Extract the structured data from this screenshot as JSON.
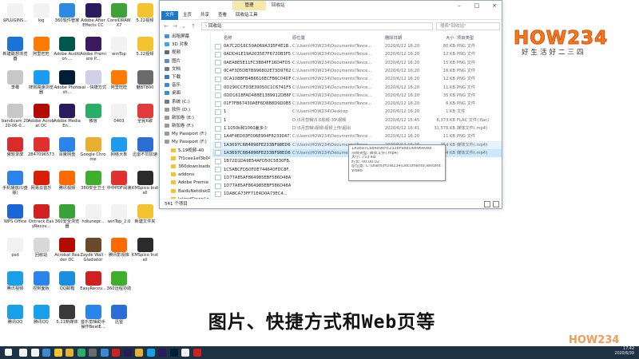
{
  "desktop": {
    "icons": [
      {
        "label": "$PLUGINS...",
        "color": "#f2f2f2"
      },
      {
        "label": "log",
        "color": "#f2f2f2"
      },
      {
        "label": "360软件管家",
        "color": "#2d8ae0"
      },
      {
        "label": "Adobe After Effects CC",
        "color": "#2a1a5e"
      },
      {
        "label": "CorelDRAW X7",
        "color": "#3fa13a"
      },
      {
        "label": "5.22视频",
        "color": "#f4c430"
      },
      {
        "label": "新建联想浏览器",
        "color": "#1b73d6"
      },
      {
        "label": "阿里旺旺",
        "color": "#ff7a00"
      },
      {
        "label": "Adobe Audition ...",
        "color": "#00574b"
      },
      {
        "label": "Adobe Premiere P...",
        "color": "#3b1a5e"
      },
      {
        "label": "winTop",
        "color": "#f2f2f2"
      },
      {
        "label": "5.22视频",
        "color": "#f4c430"
      },
      {
        "label": "李霉",
        "color": "#c8c8c8"
      },
      {
        "label": "搜狗高速浏览器",
        "color": "#1c9bf0"
      },
      {
        "label": "Adobe Photosh...",
        "color": "#001e36"
      },
      {
        "label": "sai - 快捷方式",
        "color": "#d0d0e8"
      },
      {
        "label": "阿里旺旺",
        "color": "#ff7a00"
      },
      {
        "label": "魅BT800",
        "color": "#6b6b6b"
      },
      {
        "label": "bandicam 2020-06-0...",
        "color": "#c8c8c8"
      },
      {
        "label": "Adobe Acrobat DC",
        "color": "#b30b00"
      },
      {
        "label": "Adobe Media En...",
        "color": "#2a1a5e"
      },
      {
        "label": "微信",
        "color": "#2aae67"
      },
      {
        "label": "0403",
        "color": "#f2f2f2"
      },
      {
        "label": "全民K歌",
        "color": "#e23a3a"
      },
      {
        "label": "傲软录屏",
        "color": "#d92b2b"
      },
      {
        "label": "2847096573",
        "color": "#e03030"
      },
      {
        "label": "百度网盘",
        "color": "#2b84ea"
      },
      {
        "label": "Google Chrome",
        "color": "#e8b030"
      },
      {
        "label": "网络大象",
        "color": "#1c9bf0"
      },
      {
        "label": "迅雷不同加速",
        "color": "#2b6fd6"
      },
      {
        "label": "手机播放(U盘版)",
        "color": "#2b84ea"
      },
      {
        "label": "网易云音乐",
        "color": "#d81e06"
      },
      {
        "label": "腾讯视频",
        "color": "#ff6a00"
      },
      {
        "label": "360安全卫士",
        "color": "#3fae2a"
      },
      {
        "label": "中中PDF阅读",
        "color": "#e03030"
      },
      {
        "label": "KMSpico Install",
        "color": "#2b2b2b"
      },
      {
        "label": "WPS Office",
        "color": "#1a66d6"
      },
      {
        "label": "Ontrack EasyRecov...",
        "color": "#d02020"
      },
      {
        "label": "360安全浏览器",
        "color": "#3aa23a"
      },
      {
        "label": "hdtunepr...",
        "color": "#f2f2f2"
      },
      {
        "label": "winTop_2.0",
        "color": "#f2f2f2"
      },
      {
        "label": "新建文件夹",
        "color": "#f4c430"
      },
      {
        "label": "psd",
        "color": "#f2f2f2"
      },
      {
        "label": "回收站",
        "color": "#d8d8d8"
      },
      {
        "label": "Acrobat Reader DC",
        "color": "#b30b00"
      },
      {
        "label": "Zayde Wall - Gladiator",
        "color": "#6b4a2a"
      },
      {
        "label": "腾讯影视库",
        "color": "#ff6a00"
      },
      {
        "label": "KMSpico Install",
        "color": "#2b2b2b"
      },
      {
        "label": "腾讯视频",
        "color": "#1aa0e8"
      },
      {
        "label": "控制面板",
        "color": "#2b84ea"
      },
      {
        "label": "QQ邮箱",
        "color": "#1a8fe0"
      },
      {
        "label": "EasyRecov...",
        "color": "#d02020"
      },
      {
        "label": "360远程协助",
        "color": "#3fae2a"
      },
      {
        "label": "",
        "color": "#ffffff"
      },
      {
        "label": "腾讯QQ",
        "color": "#1aa0e8"
      },
      {
        "label": "腾讯QQ",
        "color": "#1aa0e8"
      },
      {
        "label": "5.11新媒体",
        "color": "#3a3a3a"
      },
      {
        "label": "音乐剪辑助手操作BeatE...",
        "color": "#2b84ea"
      },
      {
        "label": "迅雷",
        "color": "#2b6fd6"
      }
    ]
  },
  "window": {
    "context_tab": "管理",
    "title": "回收站",
    "ribbon_tabs": [
      "文件",
      "主页",
      "共享",
      "查看",
      "回收站工具"
    ],
    "address": "› 回收站",
    "search_placeholder": "搜索\"回收站\"",
    "nav": [
      {
        "label": "出租屏幕",
        "color": "#4a90e2",
        "sub": false
      },
      {
        "label": "3D 对象",
        "color": "#3ea6e8",
        "sub": false
      },
      {
        "label": "视频",
        "color": "#5b6b7b",
        "sub": false
      },
      {
        "label": "图片",
        "color": "#5b8bd6",
        "sub": false
      },
      {
        "label": "文档",
        "color": "#6b7b8b",
        "sub": false
      },
      {
        "label": "下载",
        "color": "#2a7ad6",
        "sub": false
      },
      {
        "label": "音乐",
        "color": "#3a8ad6",
        "sub": false
      },
      {
        "label": "桌面",
        "color": "#3a8ad6",
        "sub": false
      },
      {
        "label": "系统 (C:)",
        "color": "#6b7b8b",
        "sub": false
      },
      {
        "label": "软件 (D:)",
        "color": "#9a9a9a",
        "sub": false
      },
      {
        "label": "新加卷 (E:)",
        "color": "#9a9a9a",
        "sub": false
      },
      {
        "label": "新加卷 (F:)",
        "color": "#9a9a9a",
        "sub": false
      },
      {
        "label": "My Passport (F:)",
        "color": "#9a9a9a",
        "sub": false
      },
      {
        "label": "My Passport (F:)",
        "color": "#9a9a9a",
        "sub": false
      },
      {
        "label": "5.19视频-40",
        "color": "#f4c430",
        "sub": true
      },
      {
        "label": "7f1cee1ef3b04",
        "color": "#f4c430",
        "sub": true
      },
      {
        "label": "360downloads",
        "color": "#f4c430",
        "sub": true
      },
      {
        "label": "addons",
        "color": "#f4c430",
        "sub": true
      },
      {
        "label": "Adobe Premie",
        "color": "#f4c430",
        "sub": true
      },
      {
        "label": "BaiduNetdiskD",
        "color": "#f4c430",
        "sub": true
      },
      {
        "label": "leigodDownLo",
        "color": "#f4c430",
        "sub": true
      }
    ],
    "columns": [
      "名称",
      "原位置",
      "删除日期",
      "大小",
      "项目类型"
    ],
    "files": [
      {
        "name": "0A7C2D16C50A069A335F4E1B...",
        "loc": "C:\\Users\\HOW234\\Documents\\Tence...",
        "date": "2020/6/12 16:20",
        "size": "80 KB",
        "type": "PNG 文件",
        "state": ""
      },
      {
        "name": "0ADD41E19A2035E7F6720B3F58...",
        "loc": "C:\\Users\\HOW234\\Documents\\Tence...",
        "date": "2020/6/12 16:20",
        "size": "12 KB",
        "type": "PNG 文件",
        "state": ""
      },
      {
        "name": "0AEA8E5E11FC3B84FF16D4FD51...",
        "loc": "C:\\Users\\HOW234\\Documents\\Tence...",
        "date": "2020/6/12 16:20",
        "size": "15 KB",
        "type": "PNG 文件",
        "state": ""
      },
      {
        "name": "0C4F305DB7B996802E73D9762...",
        "loc": "C:\\Users\\HOW234\\Documents\\Tence...",
        "date": "2020/6/12 16:20",
        "size": "16 KB",
        "type": "PNG 文件",
        "state": ""
      },
      {
        "name": "0CA108BFB4B6616ECFB6C04DF6...",
        "loc": "C:\\Users\\HOW234\\Documents\\Tence...",
        "date": "2020/6/12 16:20",
        "size": "12 KB",
        "type": "PNG 文件",
        "state": ""
      },
      {
        "name": "0D290CCFD3E39050C1C6741F5...",
        "loc": "C:\\Users\\HOW234\\Documents\\Tence...",
        "date": "2020/6/12 16:20",
        "size": "11 KB",
        "type": "PNG 文件",
        "state": ""
      },
      {
        "name": "0DD161BFAD488E1389912DB6F...",
        "loc": "C:\\Users\\HOW234\\Documents\\Tence...",
        "date": "2020/6/12 16:20",
        "size": "35 KB",
        "type": "PNG 文件",
        "state": ""
      },
      {
        "name": "01F7FB67430AEF6D8B8D9D0B5...",
        "loc": "C:\\Users\\HOW234\\Documents\\Tence...",
        "date": "2020/6/12 16:20",
        "size": "6 KB",
        "type": "PNG 文件",
        "state": ""
      },
      {
        "name": "1",
        "loc": "C:\\Users\\HOW234\\Desktop",
        "date": "2020/6/12 16:20",
        "size": "1 KB",
        "type": "文件",
        "state": ""
      },
      {
        "name": "1",
        "loc": "D:\\5月剪辑\\5.6视频-39\\视频",
        "date": "2020/6/12 15:45",
        "size": "6,373 KB",
        "type": "FLAC 文件(.flac)",
        "state": ""
      },
      {
        "name": "1.1050k和1060差多少",
        "loc": "D:\\5月剪辑\\视频\\视频上传\\超出",
        "date": "2020/6/12 16:41",
        "size": "31,576 KB",
        "type": "媒体文件(.mp4)",
        "state": ""
      },
      {
        "name": "1A4F4ED03F006E904F823304715...",
        "loc": "C:\\Users\\HOW234\\Documents\\Tence...",
        "date": "2020/6/12 16:20",
        "size": "11 KB",
        "type": "PNG 文件",
        "state": ""
      },
      {
        "name": "1A3697C6B4896FE233BF98ED66...",
        "loc": "C:\\Users\\HOW234\\Documents\\Tence...",
        "date": "2020/6/12 16:20",
        "size": "754 KB",
        "type": "媒体文件(.mp4)",
        "state": "hover"
      },
      {
        "name": "1A3697C6B4896FE233BF98ED66...",
        "loc": "C:\\Users\\HOW234\\Documents\\Tence...",
        "date": "2020/6/12 16:20",
        "size": "754 KB",
        "type": "媒体文件(.mp4)",
        "state": "sel"
      },
      {
        "name": "1B72D1DA9E54AFD50C5830FB...",
        "loc": "",
        "date": "",
        "size": "",
        "type": "",
        "state": ""
      },
      {
        "name": "1C5ABCFD50FDE744640FDC8F...",
        "loc": "",
        "date": "",
        "size": "",
        "type": "",
        "state": ""
      },
      {
        "name": "1D77A85AF864985EBF586D48A...",
        "loc": "",
        "date": "",
        "size": "",
        "type": "",
        "state": ""
      },
      {
        "name": "1D77A85AF864985EBF586D48A...",
        "loc": "",
        "date": "",
        "size": "",
        "type": "",
        "state": ""
      },
      {
        "name": "1DA8CA73FF71E4D0A73EC4...",
        "loc": "",
        "date": "",
        "size": "",
        "type": "",
        "state": ""
      },
      {
        "name": "1E859559981F043E28F73F4A3...",
        "loc": "C:\\Users\\HOW234\\Documents\\Tence...",
        "date": "2020/6/12 16:20",
        "size": "13 KB",
        "type": "PNG 文件",
        "state": ""
      },
      {
        "name": "1E859559981F043E28F73F4A3...",
        "loc": "C:\\Users\\HOW234\\Documents\\Tence...",
        "date": "2020/6/12 16:20",
        "size": "11 KB",
        "type": "PNG 文件",
        "state": ""
      },
      {
        "name": "1EF2ED8469F466BF1C8F684C...",
        "loc": "C:\\Users\\HOW234\\Documents\\Tence...",
        "date": "2020/6/12 16:20",
        "size": "12 KB",
        "type": "PNG 文件",
        "state": ""
      }
    ],
    "tooltip": [
      "1A3697C6B4896FE2338F98ED66964088",
      "项目类型: 媒体文件(.mp4)",
      "大小: 753 KB",
      "时长: 00:00:02",
      "原位置: C:\\Users\\HOW234\\Documents\\Tencent Files\\798521204\\",
      "Video"
    ],
    "status": "541 个项目"
  },
  "logo": {
    "word": "HOW234",
    "slogan": "好生活好二三四"
  },
  "subtitle": "图片、快捷方式和Web页等",
  "taskbar": {
    "time": "17:42",
    "date": "2020/6/30",
    "apps": [
      "#f2f2f2",
      "#f2f2f2",
      "#3a8ad6",
      "#f4c430",
      "#e8b030",
      "#2aae67",
      "#6b6b6b",
      "#3a8ad6",
      "#d02020",
      "#2a1a5e",
      "#e8b030",
      "#1aa0e8",
      "#2a1a5e",
      "#001e36",
      "#f2f2f2",
      "#d02020"
    ]
  },
  "watermark": "HOW234",
  "colors": {
    "accent": "#1979ca",
    "logo_orange": "#f07a1c",
    "selection": "#cce8ff",
    "taskbar": "#1e3245"
  }
}
